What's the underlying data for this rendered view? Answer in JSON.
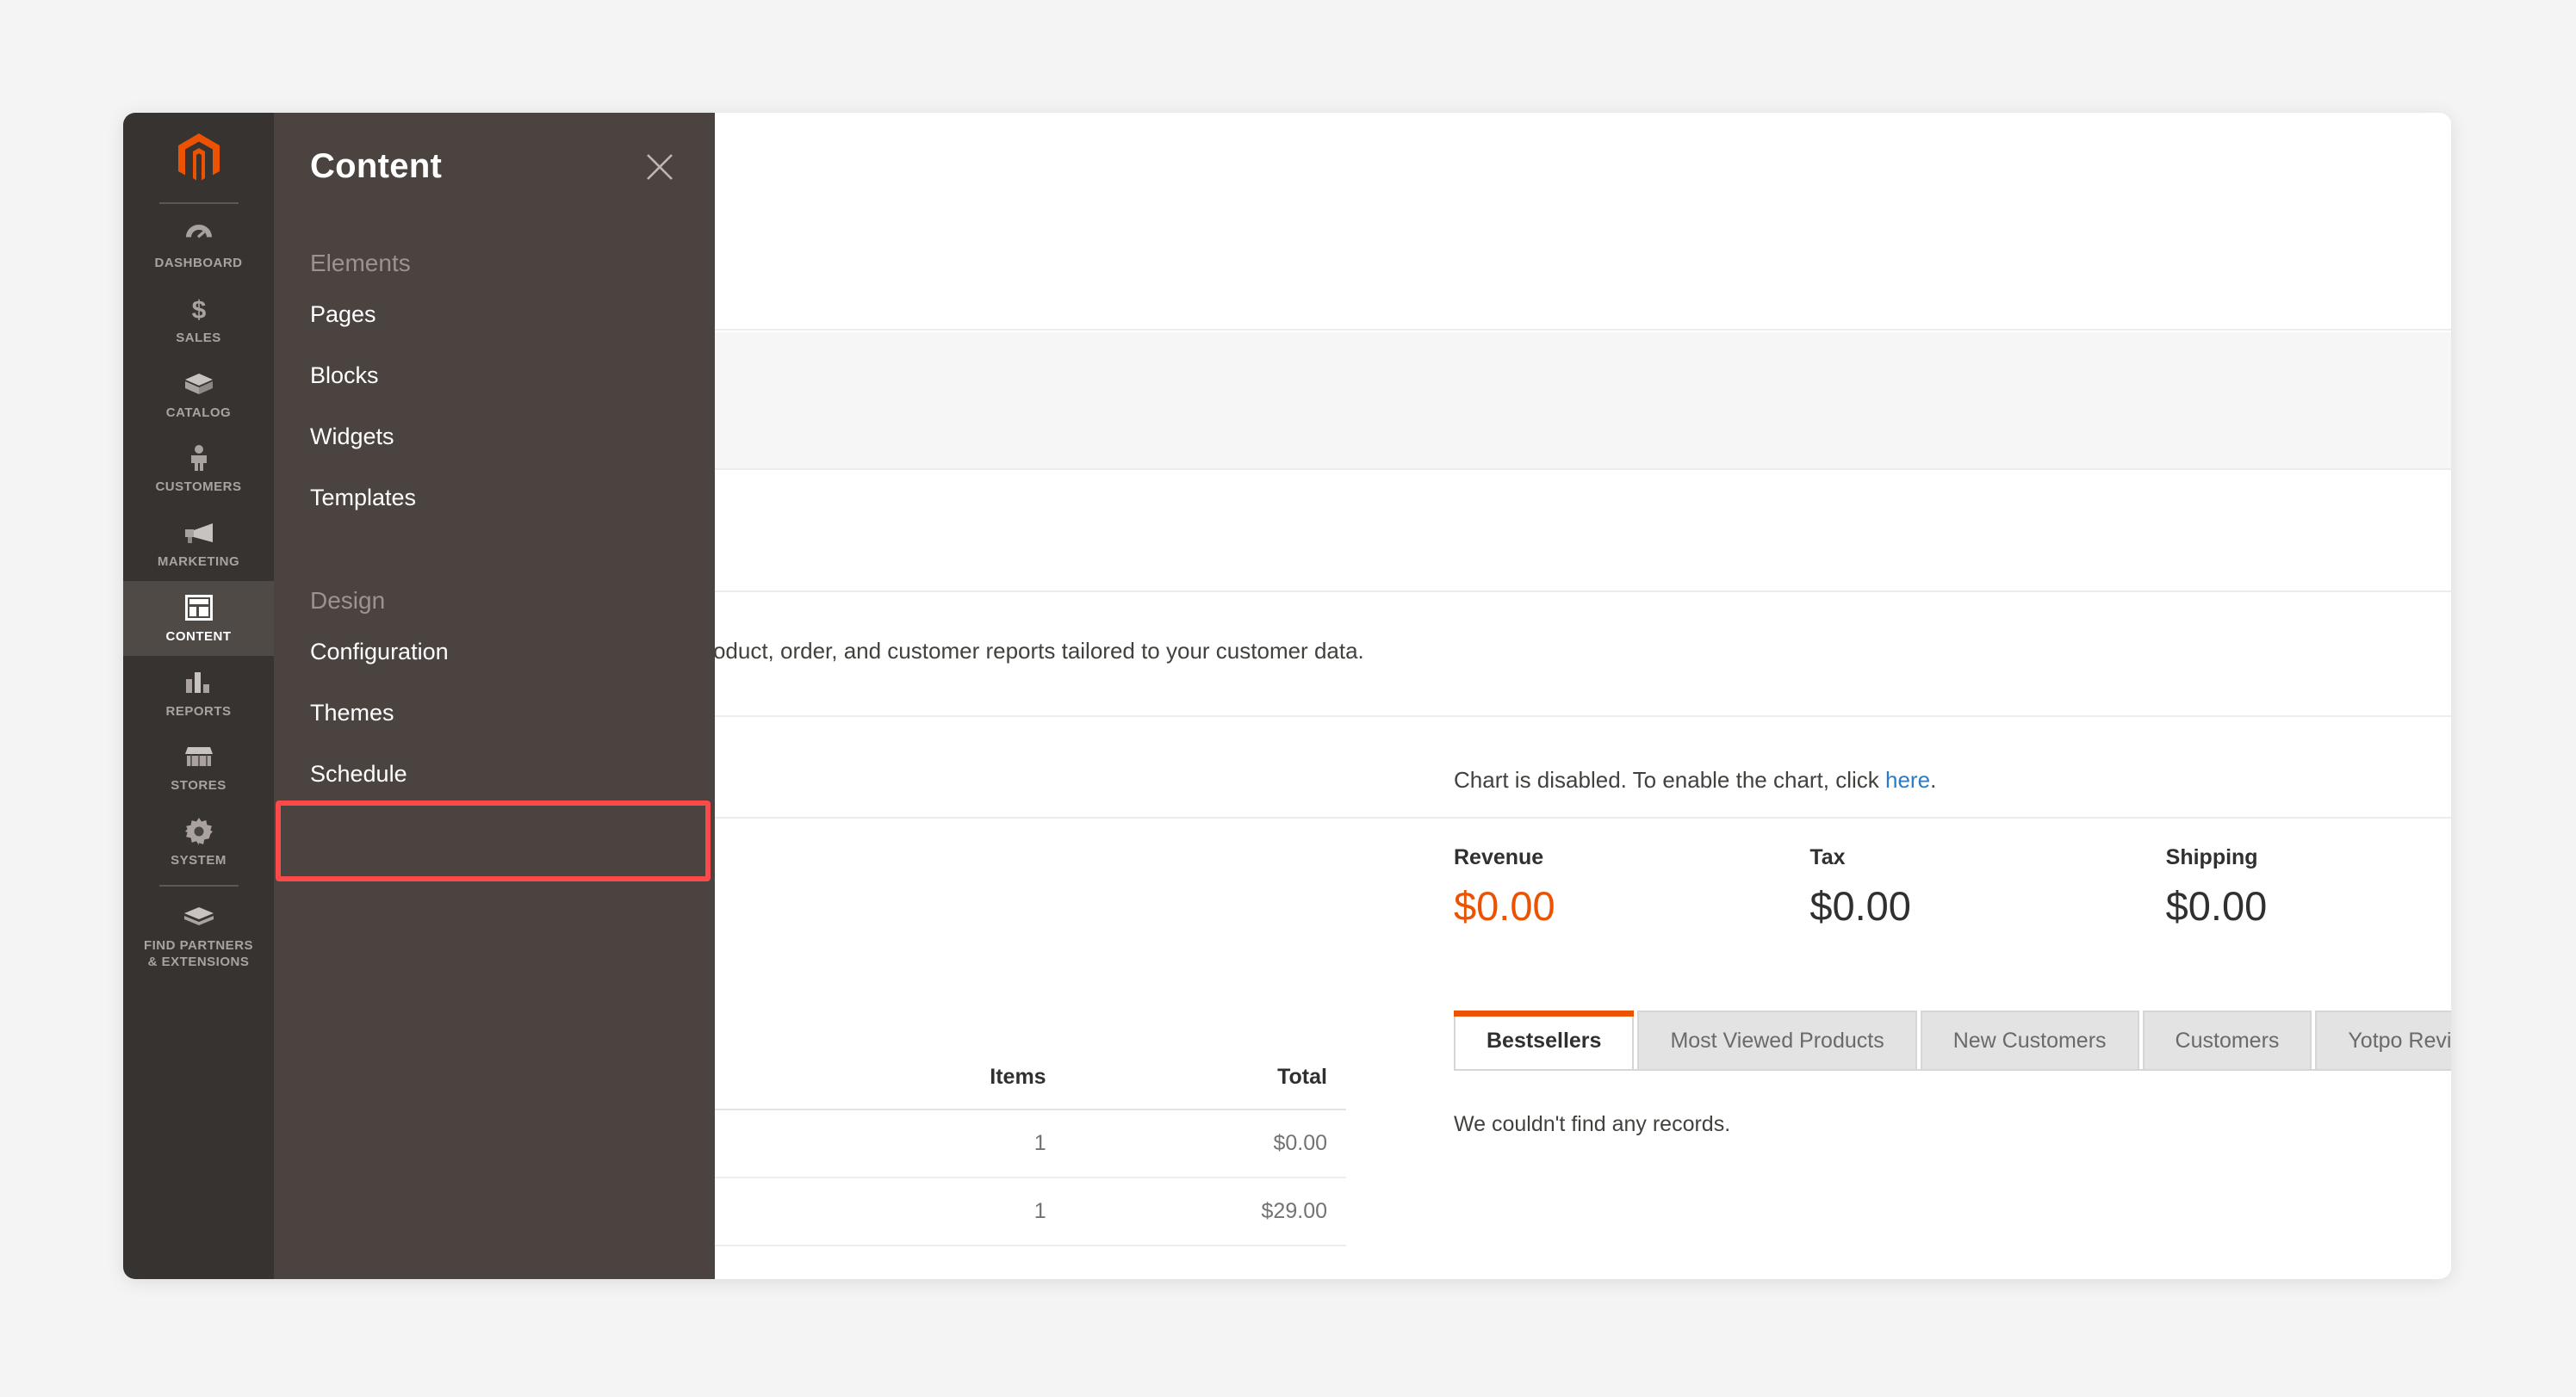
{
  "app": {
    "brand": "magento-logo",
    "background_color": "#f4f4f4",
    "accent_color": "#eb5202",
    "nav_bg": "#373330",
    "flyout_bg": "#4a4340",
    "highlight_color": "#fa4a4a",
    "link_color": "#2a7cc7"
  },
  "sidebar": {
    "items": [
      {
        "label": "DASHBOARD",
        "icon": "gauge-icon",
        "active": false
      },
      {
        "label": "SALES",
        "icon": "dollar-icon",
        "active": false
      },
      {
        "label": "CATALOG",
        "icon": "box-icon",
        "active": false
      },
      {
        "label": "CUSTOMERS",
        "icon": "person-icon",
        "active": false
      },
      {
        "label": "MARKETING",
        "icon": "megaphone-icon",
        "active": false
      },
      {
        "label": "CONTENT",
        "icon": "layout-icon",
        "active": true
      },
      {
        "label": "REPORTS",
        "icon": "bar-chart-icon",
        "active": false
      },
      {
        "label": "STORES",
        "icon": "storefront-icon",
        "active": false
      },
      {
        "label": "SYSTEM",
        "icon": "gear-icon",
        "active": false
      },
      {
        "label": "FIND PARTNERS\n& EXTENSIONS",
        "label_line1": "FIND PARTNERS",
        "label_line2": "& EXTENSIONS",
        "icon": "package-icon",
        "active": false
      }
    ]
  },
  "flyout": {
    "title": "Content",
    "close_icon": "close-icon",
    "groups": [
      {
        "title": "Elements",
        "items": [
          {
            "label": "Pages",
            "highlighted": false
          },
          {
            "label": "Blocks",
            "highlighted": false
          },
          {
            "label": "Widgets",
            "highlighted": false
          },
          {
            "label": "Templates",
            "highlighted": false
          }
        ]
      },
      {
        "title": "Design",
        "items": [
          {
            "label": "Configuration",
            "highlighted": true
          },
          {
            "label": "Themes",
            "highlighted": false
          },
          {
            "label": "Schedule",
            "highlighted": false
          }
        ]
      }
    ]
  },
  "dashboard": {
    "description": "d of your business' performance, using our dynamic product, order, and customer reports tailored to your customer data.",
    "chart_note_prefix": "Chart is disabled. To enable the chart, click ",
    "chart_note_link": "here",
    "chart_note_suffix": ".",
    "totals": [
      {
        "label": "Revenue",
        "value": "$0.00",
        "accent": true
      },
      {
        "label": "Tax",
        "value": "$0.00",
        "accent": false
      },
      {
        "label": "Shipping",
        "value": "$0.00",
        "accent": false
      }
    ],
    "orders_table": {
      "columns": [
        "",
        "Items",
        "Total"
      ],
      "rows": [
        [
          "",
          "1",
          "$0.00"
        ],
        [
          "",
          "1",
          "$29.00"
        ]
      ]
    },
    "tabs": [
      {
        "label": "Bestsellers",
        "active": true
      },
      {
        "label": "Most Viewed Products",
        "active": false
      },
      {
        "label": "New Customers",
        "active": false
      },
      {
        "label": "Customers",
        "active": false
      },
      {
        "label": "Yotpo Reviews",
        "active": false
      }
    ],
    "tab_empty_message": "We couldn't find any records."
  }
}
